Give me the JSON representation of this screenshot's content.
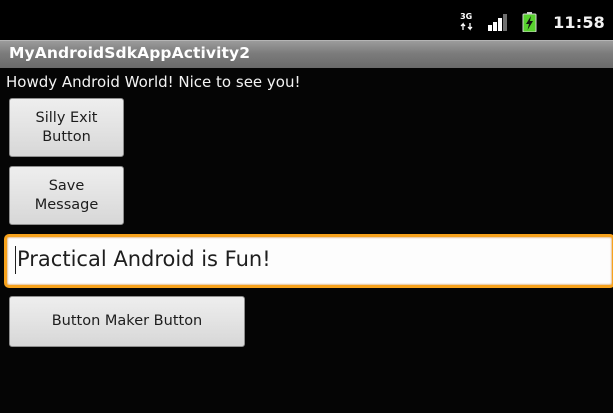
{
  "status_bar": {
    "network_label": "3G",
    "time": "11:58"
  },
  "app": {
    "title": "MyAndroidSdkAppActivity2"
  },
  "main": {
    "greeting": "Howdy Android World! Nice to see you!",
    "exit_button": {
      "line1": "Silly Exit",
      "line2": "Button"
    },
    "save_button": {
      "line1": "Save",
      "line2": "Message"
    },
    "edit_field": {
      "value": "Practical Android is Fun!"
    },
    "maker_button": {
      "label": "Button Maker Button"
    }
  },
  "colors": {
    "screen_background": "#050505",
    "title_bar": "#7c7c7c",
    "focus_border": "#f7a21c",
    "battery_green": "#57d12d"
  },
  "icons": [
    "3g-icon",
    "signal-icon",
    "battery-charging-icon"
  ]
}
